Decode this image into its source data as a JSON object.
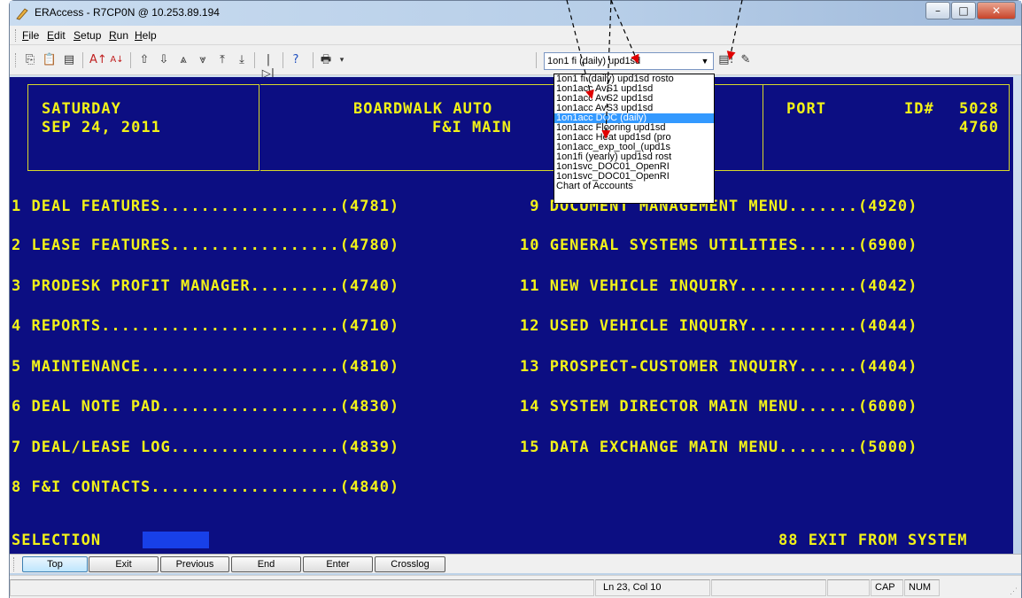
{
  "window": {
    "title": "ERAccess - R7CP0N @ 10.253.89.194",
    "minimize": "–",
    "maximize": "□",
    "close": "✕"
  },
  "menu": [
    {
      "prefix": "",
      "key": "F",
      "rest": "ile"
    },
    {
      "prefix": "",
      "key": "E",
      "rest": "dit"
    },
    {
      "prefix": "",
      "key": "S",
      "rest": "etup"
    },
    {
      "prefix": "",
      "key": "R",
      "rest": "un"
    },
    {
      "prefix": "",
      "key": "H",
      "rest": "elp"
    }
  ],
  "toolbar": {
    "combo_value": "1on1 fi (daily) upd1sd",
    "combo_arrow": "▼"
  },
  "dropdown": {
    "items": [
      "1on1 fi (daily) upd1sd rosto",
      "1on1acc AvS1 upd1sd",
      "1on1acc AvS2 upd1sd",
      "1on1acc AvS3 upd1sd",
      "1on1acc DOC (daily)",
      "1on1acc Flooring upd1sd",
      "1on1acc Heat upd1sd (pro",
      "1on1acc_exp_tool_(upd1s",
      "1on1fi (yearly) upd1sd rost",
      "1on1svc_DOC01_OpenRI",
      "1on1svc_DOC01_OpenRI",
      "Chart of Accounts"
    ],
    "selected_index": 4
  },
  "terminal": {
    "header_left_line1": "SATURDAY",
    "header_left_line2": "SEP 24, 2011",
    "header_mid_line1": "BOARDWALK AUTO",
    "header_mid_line2": "F&I MAIN",
    "header_right_port": "PORT",
    "header_right_id_label": "ID#",
    "header_right_id1": "5028",
    "header_right_id2": "4760",
    "menu_left": [
      "1 DEAL FEATURES..................(4781)",
      "2 LEASE FEATURES.................(4780)",
      "3 PRODESK PROFIT MANAGER.........(4740)",
      "4 REPORTS........................(4710)",
      "5 MAINTENANCE....................(4810)",
      "6 DEAL NOTE PAD..................(4830)",
      "7 DEAL/LEASE LOG.................(4839)",
      "8 F&I CONTACTS...................(4840)"
    ],
    "menu_right": [
      " 9 DOCUMENT MANAGEMENT MENU.......(4920)",
      "10 GENERAL SYSTEMS UTILITIES......(6900)",
      "11 NEW VEHICLE INQUIRY............(4042)",
      "12 USED VEHICLE INQUIRY...........(4044)",
      "13 PROSPECT-CUSTOMER INQUIRY......(4404)",
      "14 SYSTEM DIRECTOR MAIN MENU......(6000)",
      "15 DATA EXCHANGE MAIN MENU........(5000)"
    ],
    "selection_label": "SELECTION",
    "exit_label": "88 EXIT FROM SYSTEM"
  },
  "fkeys": [
    "Top",
    "Exit",
    "Previous",
    "End",
    "Enter",
    "Crosslog"
  ],
  "status": {
    "position": "Ln 23, Col 10",
    "cap": "CAP",
    "num": "NUM"
  },
  "colors": {
    "terminal_bg": "#0c0e82",
    "terminal_fg": "#f2f218",
    "selection_field": "#1840e8",
    "annotation": "#e00000"
  }
}
